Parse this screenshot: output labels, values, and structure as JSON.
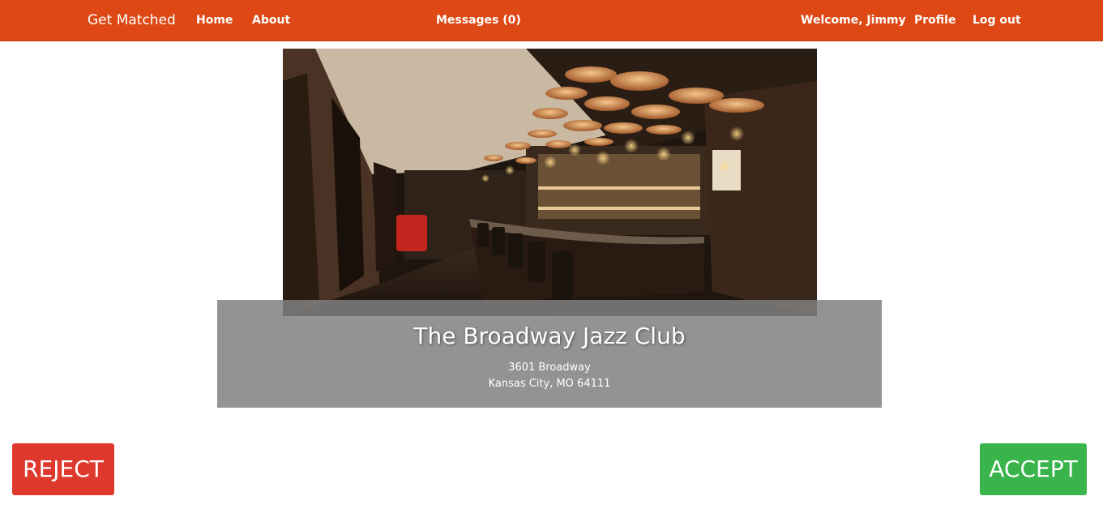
{
  "nav": {
    "brand": "Get Matched",
    "home": "Home",
    "about": "About",
    "messages": "Messages (0)",
    "welcome": "Welcome, Jimmy",
    "profile": "Profile",
    "logout": "Log out"
  },
  "venue": {
    "name": "The Broadway Jazz Club",
    "address_line1": "3601 Broadway",
    "address_line2": "Kansas City, MO 64111",
    "photo_alt": "Bar interior with cymbal-shaped pendant lights"
  },
  "actions": {
    "reject_label": "REJECT",
    "accept_label": "ACCEPT"
  },
  "colors": {
    "navbar": "#DD4814",
    "panel": "#808080",
    "reject": "#DF382C",
    "accept": "#38B44A"
  }
}
